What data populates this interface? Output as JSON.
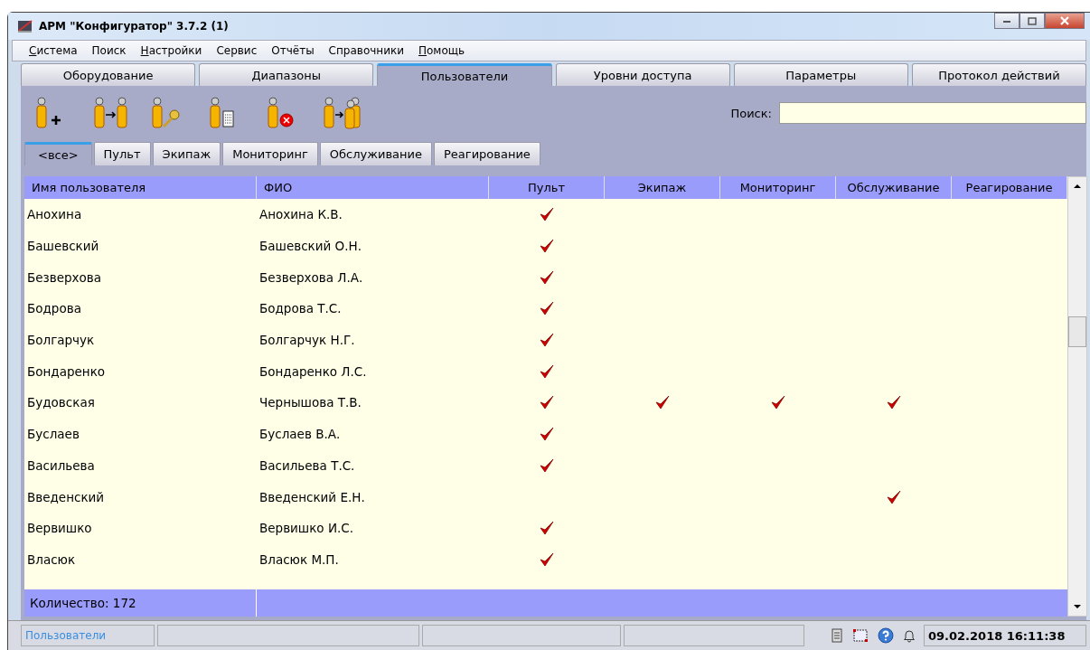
{
  "window": {
    "title": "АРМ \"Конфигуратор\" 3.7.2 (1)"
  },
  "menu": [
    {
      "label": "Система",
      "accel": true
    },
    {
      "label": "Поиск",
      "accel": false
    },
    {
      "label": "Настройки",
      "accel": true
    },
    {
      "label": "Сервис",
      "accel": false
    },
    {
      "label": "Отчёты",
      "accel": false
    },
    {
      "label": "Справочники",
      "accel": false
    },
    {
      "label": "Помощь",
      "accel": true
    }
  ],
  "tabs": [
    {
      "label": "Оборудование",
      "selected": false
    },
    {
      "label": "Диапазоны",
      "selected": false
    },
    {
      "label": "Пользователи",
      "selected": true
    },
    {
      "label": "Уровни доступа",
      "selected": false
    },
    {
      "label": "Параметры",
      "selected": false
    },
    {
      "label": "Протокол действий",
      "selected": false
    }
  ],
  "search": {
    "label": "Поиск:"
  },
  "subtabs": [
    {
      "label": "<все>",
      "selected": true
    },
    {
      "label": "Пульт",
      "selected": false
    },
    {
      "label": "Экипаж",
      "selected": false
    },
    {
      "label": "Мониторинг",
      "selected": false
    },
    {
      "label": "Обслуживание",
      "selected": false
    },
    {
      "label": "Реагирование",
      "selected": false
    }
  ],
  "table": {
    "columns": [
      "Имя пользователя",
      "ФИО",
      "Пульт",
      "Экипаж",
      "Мониторинг",
      "Обслуживание",
      "Реагирование"
    ],
    "rows": [
      {
        "cells": [
          "Анохина",
          "Анохина К.В."
        ],
        "checks": [
          true,
          false,
          false,
          false,
          false
        ]
      },
      {
        "cells": [
          "Башевский",
          "Башевский О.Н."
        ],
        "checks": [
          true,
          false,
          false,
          false,
          false
        ]
      },
      {
        "cells": [
          "Безверхова",
          "Безверхова Л.А."
        ],
        "checks": [
          true,
          false,
          false,
          false,
          false
        ]
      },
      {
        "cells": [
          "Бодрова",
          "Бодрова Т.С."
        ],
        "checks": [
          true,
          false,
          false,
          false,
          false
        ]
      },
      {
        "cells": [
          "Болгарчук",
          "Болгарчук Н.Г."
        ],
        "checks": [
          true,
          false,
          false,
          false,
          false
        ]
      },
      {
        "cells": [
          "Бондаренко",
          "Бондаренко Л.С."
        ],
        "checks": [
          true,
          false,
          false,
          false,
          false
        ]
      },
      {
        "cells": [
          "Будовская",
          "Чернышова Т.В."
        ],
        "checks": [
          true,
          true,
          true,
          true,
          false
        ]
      },
      {
        "cells": [
          "Буслаев",
          "Буслаев В.А."
        ],
        "checks": [
          true,
          false,
          false,
          false,
          false
        ]
      },
      {
        "cells": [
          "Васильева",
          "Васильева Т.С."
        ],
        "checks": [
          true,
          false,
          false,
          false,
          false
        ]
      },
      {
        "cells": [
          "Введенский",
          "Введенский Е.Н."
        ],
        "checks": [
          false,
          false,
          false,
          true,
          false
        ]
      },
      {
        "cells": [
          "Вервишко",
          "Вервишко И.С."
        ],
        "checks": [
          true,
          false,
          false,
          false,
          false
        ]
      },
      {
        "cells": [
          "Власюк",
          "Власюк М.П."
        ],
        "checks": [
          true,
          false,
          false,
          false,
          false
        ]
      }
    ],
    "footer": "Количество: 172"
  },
  "status_bar": {
    "section": "Пользователи",
    "datetime": "09.02.2018 16:11:38"
  }
}
